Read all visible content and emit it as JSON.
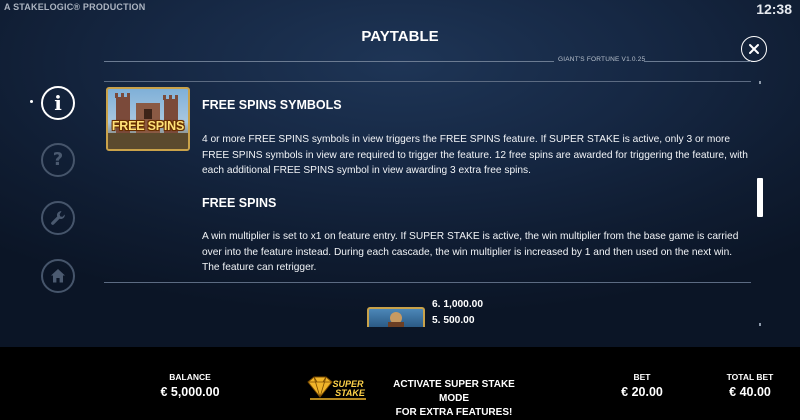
{
  "header": {
    "credit": "A STAKELOGIC® PRODUCTION",
    "clock": "12:38",
    "title": "PAYTABLE",
    "version": "GIANT'S FORTUNE V1.0.25"
  },
  "nav": {
    "items": [
      {
        "name": "info",
        "icon": "info-icon",
        "active": true
      },
      {
        "name": "help",
        "icon": "question-icon",
        "active": false
      },
      {
        "name": "settings",
        "icon": "wrench-icon",
        "active": false
      },
      {
        "name": "home",
        "icon": "home-icon",
        "active": false
      }
    ]
  },
  "content": {
    "symbol_label": "FREE SPINS",
    "free_spins_symbols_heading": "FREE SPINS SYMBOLS",
    "free_spins_symbols_text": "4 or more FREE SPINS symbols in view triggers the FREE SPINS feature. If SUPER STAKE is active, only 3 or more FREE SPINS symbols in view are required to trigger the feature. 12 free spins are awarded for triggering the feature, with each additional FREE SPINS symbol in view awarding 3 extra free spins.",
    "free_spins_heading": "FREE SPINS",
    "free_spins_text": "A win multiplier is set to x1 on feature entry. If SUPER STAKE is active, the win multiplier from the base game is carried over into the feature instead. During each cascade, the win multiplier is increased by 1 and then used on the next win. The feature can retrigger.",
    "pays": [
      {
        "count": "6.",
        "amount": "1,000.00"
      },
      {
        "count": "5.",
        "amount": "500.00"
      }
    ]
  },
  "footer": {
    "balance_label": "BALANCE",
    "balance_value": "€ 5,000.00",
    "super_stake_line1": "ACTIVATE SUPER STAKE MODE",
    "super_stake_line2": "FOR EXTRA FEATURES!",
    "super_stake_logo_line1": "SUPER",
    "super_stake_logo_line2": "STAKE",
    "bet_label": "BET",
    "bet_value": "€ 20.00",
    "total_bet_label": "TOTAL BET",
    "total_bet_value": "€ 40.00"
  },
  "colors": {
    "background": "#162844",
    "gold": "#c9a24a",
    "nav_inactive": "#46556b"
  }
}
